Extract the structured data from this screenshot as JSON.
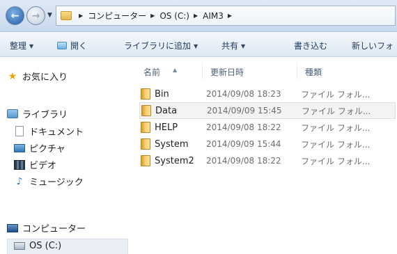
{
  "address": {
    "crumbs": [
      "コンピューター",
      "OS (C:)",
      "AIM3"
    ]
  },
  "toolbar": {
    "organize": "整理",
    "open": "開く",
    "add_to_library": "ライブラリに追加",
    "share": "共有",
    "burn": "書き込む",
    "new_folder": "新しいフォ"
  },
  "nav": {
    "favorites": "お気に入り",
    "libraries": "ライブラリ",
    "documents": "ドキュメント",
    "pictures": "ピクチャ",
    "videos": "ビデオ",
    "music": "ミュージック",
    "computer": "コンピューター",
    "drive": "OS (C:)"
  },
  "columns": {
    "name": "名前",
    "modified": "更新日時",
    "type": "種類"
  },
  "files": [
    {
      "name": "Bin",
      "modified": "2014/09/08 18:23",
      "type": "ファイル フォル..."
    },
    {
      "name": "Data",
      "modified": "2014/09/09 15:45",
      "type": "ファイル フォル..."
    },
    {
      "name": "HELP",
      "modified": "2014/09/08 18:22",
      "type": "ファイル フォル..."
    },
    {
      "name": "System",
      "modified": "2014/09/09 15:44",
      "type": "ファイル フォル..."
    },
    {
      "name": "System2",
      "modified": "2014/09/08 18:22",
      "type": "ファイル フォル..."
    }
  ]
}
